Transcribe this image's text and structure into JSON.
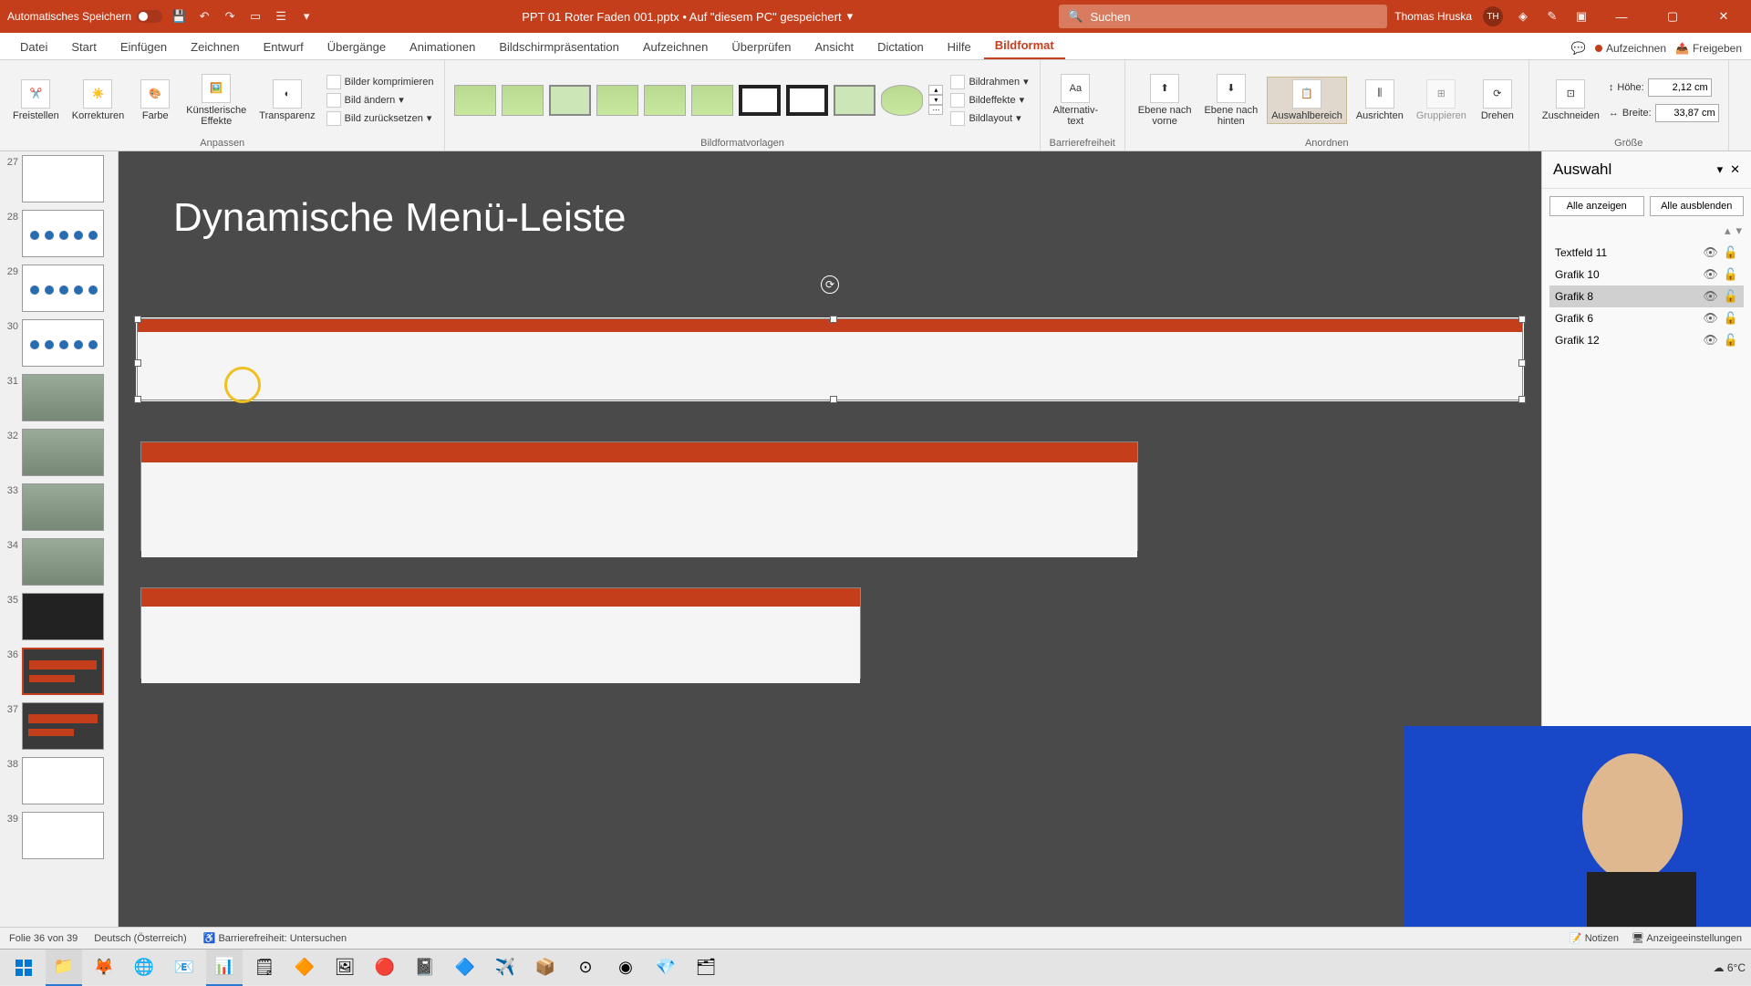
{
  "titlebar": {
    "autosave_label": "Automatisches Speichern",
    "filename": "PPT 01 Roter Faden 001.pptx • Auf \"diesem PC\" gespeichert",
    "search_placeholder": "Suchen",
    "user_name": "Thomas Hruska",
    "user_initials": "TH"
  },
  "tabs": {
    "items": [
      "Datei",
      "Start",
      "Einfügen",
      "Zeichnen",
      "Entwurf",
      "Übergänge",
      "Animationen",
      "Bildschirmpräsentation",
      "Aufzeichnen",
      "Überprüfen",
      "Ansicht",
      "Dictation",
      "Hilfe",
      "Bildformat"
    ],
    "active": "Bildformat",
    "record_label": "Aufzeichnen",
    "share_label": "Freigeben"
  },
  "ribbon": {
    "anpassen": {
      "freistellen": "Freistellen",
      "korrekturen": "Korrekturen",
      "farbe": "Farbe",
      "effekte": "Künstlerische\nEffekte",
      "transparenz": "Transparenz",
      "komprimieren": "Bilder komprimieren",
      "aendern": "Bild ändern",
      "zuruecksetzen": "Bild zurücksetzen",
      "label": "Anpassen"
    },
    "vorlagen": {
      "rahmen": "Bildrahmen",
      "effekte": "Bildeffekte",
      "layout": "Bildlayout",
      "label": "Bildformatvorlagen"
    },
    "barriere": {
      "alt": "Alternativ-\ntext",
      "label": "Barrierefreiheit"
    },
    "anordnen": {
      "vorne": "Ebene nach\nvorne",
      "hinten": "Ebene nach\nhinten",
      "bereich": "Auswahlbereich",
      "ausrichten": "Ausrichten",
      "gruppieren": "Gruppieren",
      "drehen": "Drehen",
      "label": "Anordnen"
    },
    "groesse": {
      "zuschneiden": "Zuschneiden",
      "hoehe_label": "Höhe:",
      "hoehe_val": "2,12 cm",
      "breite_label": "Breite:",
      "breite_val": "33,87 cm",
      "label": "Größe"
    }
  },
  "thumbs": [
    27,
    28,
    29,
    30,
    31,
    32,
    33,
    34,
    35,
    36,
    37,
    38,
    39
  ],
  "thumbs_selected": 36,
  "slide": {
    "title": "Dynamische Menü-Leiste"
  },
  "selection_pane": {
    "title": "Auswahl",
    "show_all": "Alle anzeigen",
    "hide_all": "Alle ausblenden",
    "items": [
      {
        "name": "Textfeld 11",
        "selected": false
      },
      {
        "name": "Grafik 10",
        "selected": false
      },
      {
        "name": "Grafik 8",
        "selected": true
      },
      {
        "name": "Grafik 6",
        "selected": false
      },
      {
        "name": "Grafik 12",
        "selected": false
      }
    ]
  },
  "statusbar": {
    "slide_info": "Folie 36 von 39",
    "language": "Deutsch (Österreich)",
    "accessibility": "Barrierefreiheit: Untersuchen",
    "notes": "Notizen",
    "display": "Anzeigeeinstellungen"
  },
  "taskbar": {
    "weather": "6°C"
  }
}
